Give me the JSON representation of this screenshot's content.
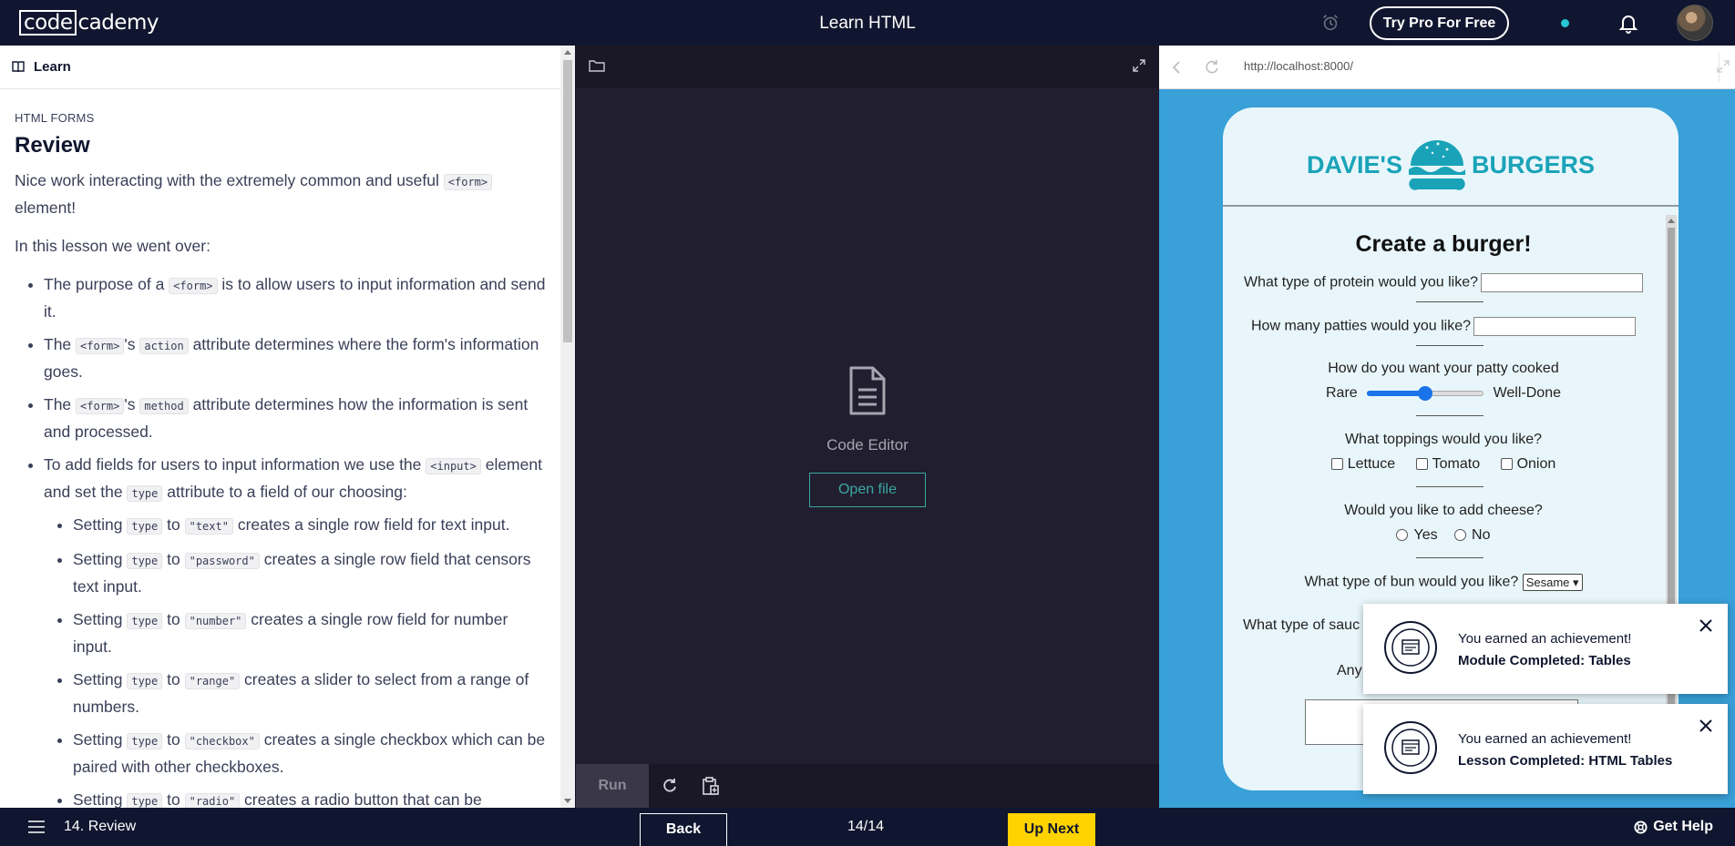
{
  "topbar": {
    "logo_part1": "code",
    "logo_part2": "cademy",
    "title": "Learn HTML",
    "try_pro": "Try Pro For Free"
  },
  "learn": {
    "header": "Learn",
    "crumb": "HTML FORMS",
    "title": "Review",
    "intro_before": "Nice work interacting with the extremely common and useful ",
    "intro_code": "<form>",
    "intro_after": " element!",
    "went_over": "In this lesson we went over:",
    "points": [
      {
        "a": "The purpose of a ",
        "c1": "<form>",
        "b": " is to allow users to input information and send it."
      },
      {
        "a": "The ",
        "c1": "<form>",
        "b": "'s ",
        "c2": "action",
        "d": " attribute determines where the form's information goes."
      },
      {
        "a": "The ",
        "c1": "<form>",
        "b": "'s ",
        "c2": "method",
        "d": " attribute determines how the information is sent and processed."
      },
      {
        "a": "To add fields for users to input information we use the ",
        "c1": "<input>",
        "b": " element and set the ",
        "c2": "type",
        "d": " attribute to a field of our choosing:"
      }
    ],
    "subpoints": [
      {
        "a": "Setting ",
        "c1": "type",
        "b": " to ",
        "c2": "\"text\"",
        "d": " creates a single row field for text input."
      },
      {
        "a": "Setting ",
        "c1": "type",
        "b": " to ",
        "c2": "\"password\"",
        "d": " creates a single row field that censors text input."
      },
      {
        "a": "Setting ",
        "c1": "type",
        "b": " to ",
        "c2": "\"number\"",
        "d": " creates a single row field for number input."
      },
      {
        "a": "Setting ",
        "c1": "type",
        "b": " to ",
        "c2": "\"range\"",
        "d": " creates a slider to select from a range of numbers."
      },
      {
        "a": "Setting ",
        "c1": "type",
        "b": " to ",
        "c2": "\"checkbox\"",
        "d": " creates a single checkbox which can be paired with other checkboxes."
      },
      {
        "a": "Setting ",
        "c1": "type",
        "b": " to ",
        "c2": "\"radio\"",
        "d": " creates a radio button that can be"
      }
    ]
  },
  "editor": {
    "label": "Code Editor",
    "open_file": "Open file",
    "run": "Run"
  },
  "browser": {
    "url": "http://localhost:8000/",
    "brand_left": "DAVIE'S",
    "brand_right": "BURGERS",
    "form_title": "Create a burger!",
    "q_protein": "What type of protein would you like?",
    "q_patties": "How many patties would you like?",
    "q_cooked": "How do you want your patty cooked",
    "range_min": "Rare",
    "range_max": "Well-Done",
    "range_value": 0.5,
    "q_toppings": "What toppings would you like?",
    "toppings": [
      "Lettuce",
      "Tomato",
      "Onion"
    ],
    "q_cheese": "Would you like to add cheese?",
    "cheese": [
      "Yes",
      "No"
    ],
    "q_bun": "What type of bun would you like?",
    "bun_selected": "Sesame",
    "q_sauce": "What type of sauc",
    "q_anything": "Any"
  },
  "toasts": [
    {
      "line1": "You earned an achievement!",
      "line2": "Module Completed: Tables"
    },
    {
      "line1": "You earned an achievement!",
      "line2": "Lesson Completed: HTML Tables"
    }
  ],
  "bottombar": {
    "lesson": "14. Review",
    "back": "Back",
    "progress": "14/14",
    "up_next": "Up Next",
    "get_help": "Get Help"
  }
}
